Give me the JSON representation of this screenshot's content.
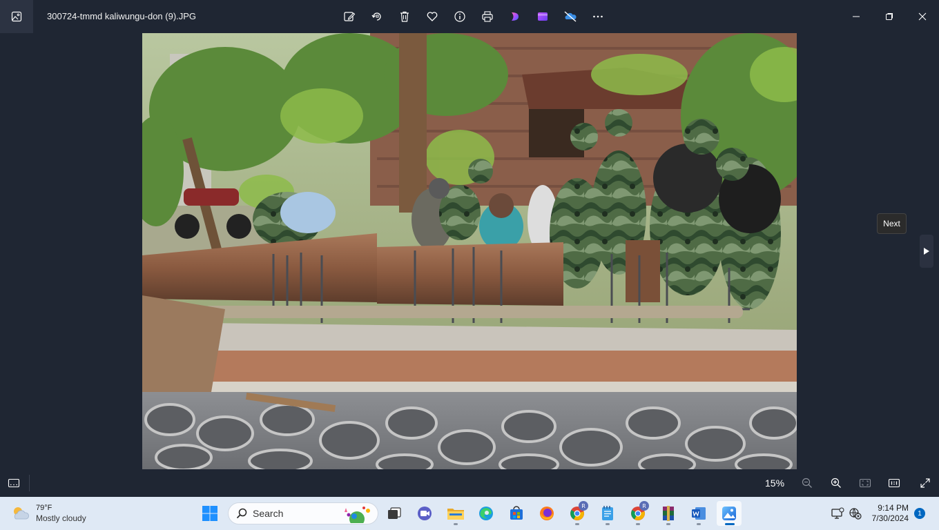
{
  "window": {
    "title": "300724-tmmd kaliwungu-don (9).JPG",
    "toolbar": [
      "edit-image",
      "rotate",
      "delete",
      "favorite",
      "file-info",
      "print",
      "clipchamp",
      "designer",
      "onedrive-off",
      "more"
    ],
    "controls": [
      "minimize",
      "maximize",
      "close"
    ]
  },
  "viewer": {
    "next_tooltip": "Next",
    "zoom_level": "15%"
  },
  "taskbar": {
    "weather": {
      "temp": "79°F",
      "condition": "Mostly cloudy"
    },
    "search_label": "Search",
    "apps": [
      {
        "name": "task-view"
      },
      {
        "name": "teams-meet"
      },
      {
        "name": "file-explorer"
      },
      {
        "name": "edge"
      },
      {
        "name": "microsoft-store"
      },
      {
        "name": "firefox"
      },
      {
        "name": "chrome-profile-r",
        "badge": "R"
      },
      {
        "name": "notepad"
      },
      {
        "name": "chrome-profile-r-2",
        "badge": "R"
      },
      {
        "name": "winrar"
      },
      {
        "name": "word"
      },
      {
        "name": "photos"
      }
    ],
    "clock": {
      "time": "9:14 PM",
      "date": "7/30/2024"
    },
    "notification_count": "1"
  },
  "colors": {
    "window_bg": "#1f2633",
    "taskbar_bg": "#dfe9f5",
    "accent": "#0067c0"
  }
}
